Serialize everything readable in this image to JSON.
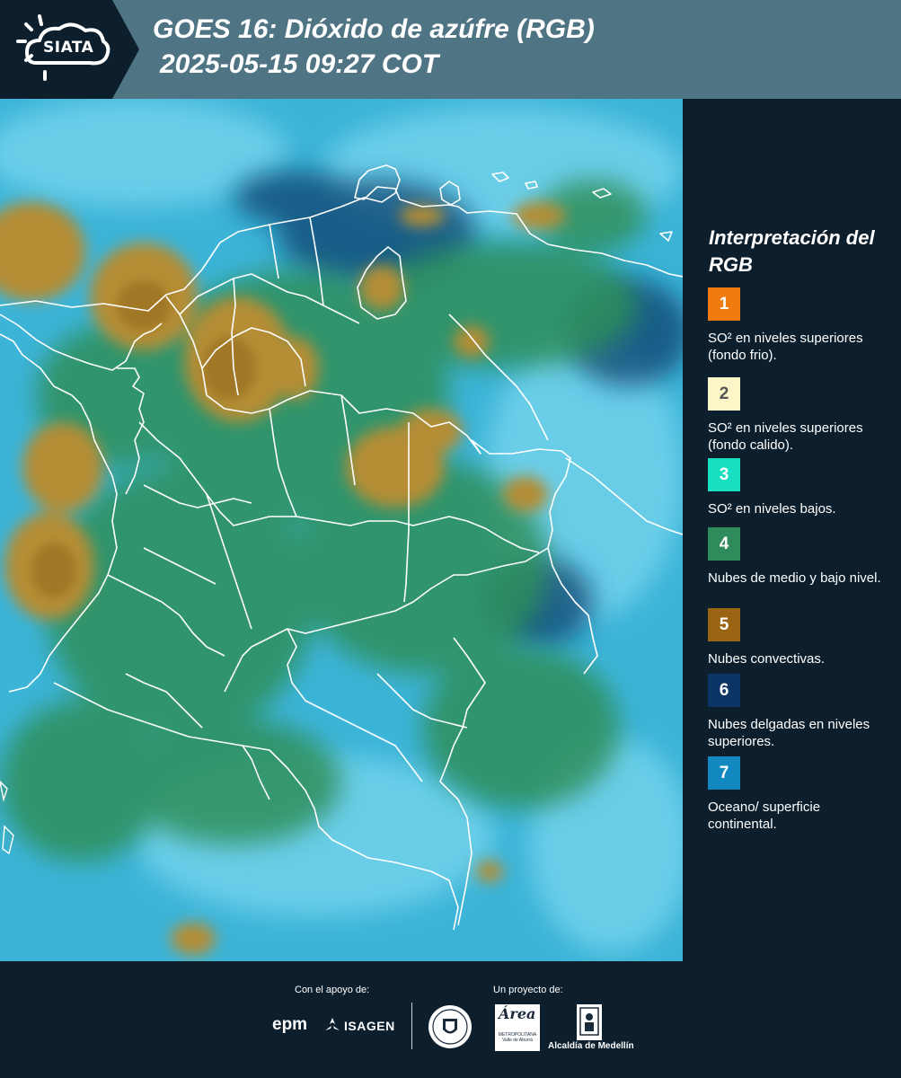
{
  "header": {
    "logo_text": "SIATA",
    "title_line1": "GOES 16: Dióxido de azúfre (RGB)",
    "title_line2": "2025-05-15 09:27 COT"
  },
  "map": {
    "product": "GOES 16 SO2 RGB composite",
    "background_color": "#3fb3d6",
    "convective_color": "#a8862f",
    "mid_low_cloud_color": "#2e8a5a",
    "border_color": "#ffffff"
  },
  "legend": {
    "title": "Interpretación del RGB",
    "items": [
      {
        "number": "1",
        "color": "#f07b0f",
        "text": "SO² en niveles superiores (fondo frio)."
      },
      {
        "number": "2",
        "color": "#fbf5c8",
        "text": "SO² en niveles superiores (fondo calido)."
      },
      {
        "number": "3",
        "color": "#18dfc0",
        "text": "SO² en niveles bajos."
      },
      {
        "number": "4",
        "color": "#2f8a5c",
        "text": "Nubes de medio y bajo nivel."
      },
      {
        "number": "5",
        "color": "#9a6412",
        "text": "Nubes convectivas."
      },
      {
        "number": "6",
        "color": "#0c3566",
        "text": "Nubes delgadas en niveles superiores."
      },
      {
        "number": "7",
        "color": "#1288c0",
        "text": "Oceano/ superficie continental."
      }
    ]
  },
  "footer": {
    "support_label": "Con el apoyo de:",
    "project_label": "Un proyecto de:",
    "sponsors": [
      "epm",
      "ISAGEN"
    ],
    "partners": [
      "Área Metropolitana Valle de Aburrá",
      "Alcaldía de Medellín"
    ],
    "epm": "epm",
    "isagen": "ISAGEN",
    "area_name": "Área",
    "area_sub": "METROPOLITANA Valle de Aburrá",
    "alcaldia": "Alcaldía de Medellín"
  }
}
